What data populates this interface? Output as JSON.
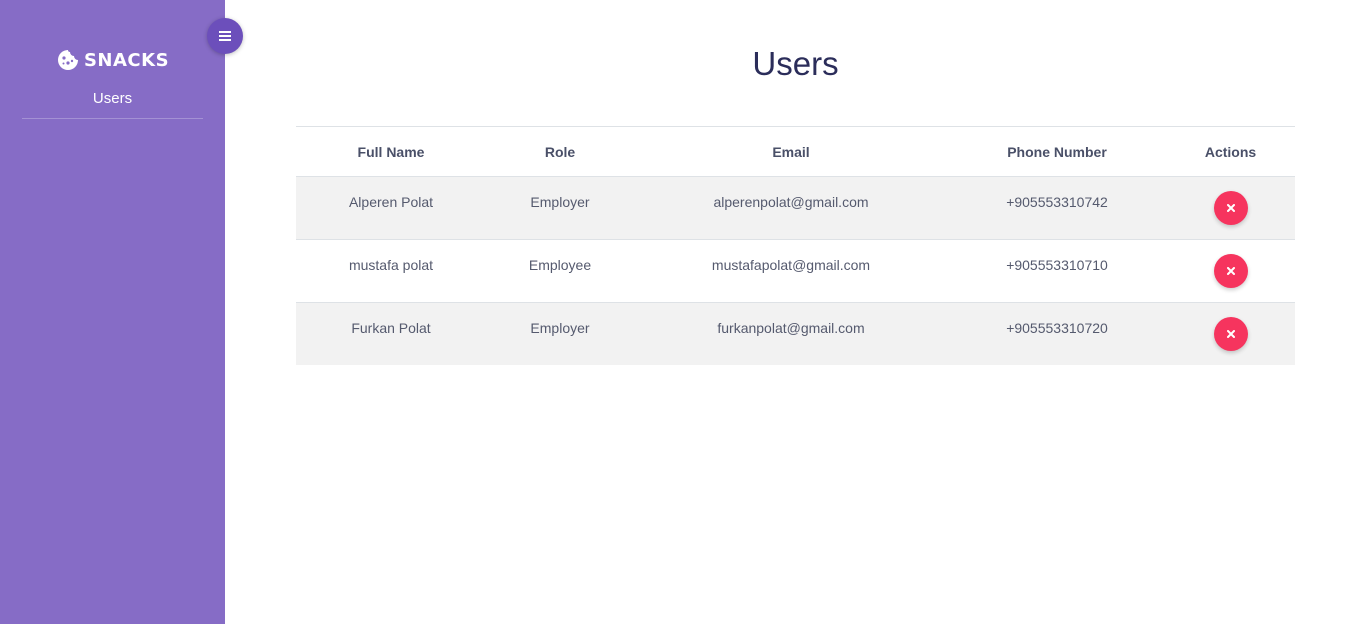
{
  "sidebar": {
    "brand": "SNACKS",
    "brand_icon": "cookie-icon",
    "items": [
      {
        "label": "Users"
      }
    ],
    "toggle_icon": "hamburger-menu-icon",
    "bg_color": "#866cc6"
  },
  "main": {
    "title": "Users",
    "table": {
      "columns": [
        "Full Name",
        "Role",
        "Email",
        "Phone Number",
        "Actions"
      ],
      "rows": [
        {
          "full_name": "Alperen Polat",
          "role": "Employer",
          "email": "alperenpolat@gmail.com",
          "phone": "+905553310742",
          "action_icon": "close-icon"
        },
        {
          "full_name": "mustafa polat",
          "role": "Employee",
          "email": "mustafapolat@gmail.com",
          "phone": "+905553310710",
          "action_icon": "close-icon"
        },
        {
          "full_name": "Furkan Polat",
          "role": "Employer",
          "email": "furkanpolat@gmail.com",
          "phone": "+905553310720",
          "action_icon": "close-icon"
        }
      ]
    },
    "delete_color": "#f6345e",
    "title_color": "#2b2d5a"
  }
}
